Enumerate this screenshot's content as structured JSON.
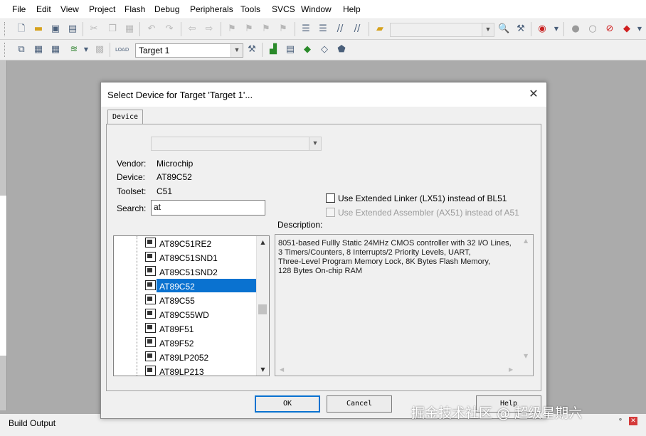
{
  "menu": [
    "File",
    "Edit",
    "View",
    "Project",
    "Flash",
    "Debug",
    "Peripherals",
    "Tools",
    "SVCS",
    "Window",
    "Help"
  ],
  "toolbar2": {
    "target_value": "Target 1"
  },
  "build_output": {
    "title": "Build Output"
  },
  "dialog": {
    "title": "Select Device for Target 'Target 1'...",
    "tab": "Device",
    "vendor_label": "Vendor:",
    "vendor_value": "Microchip",
    "device_label": "Device:",
    "device_value": "AT89C52",
    "toolset_label": "Toolset:",
    "toolset_value": "C51",
    "search_label": "Search:",
    "search_value": "at",
    "linker_option": "Use Extended Linker (LX51) instead of BL51",
    "assembler_option": "Use Extended Assembler (AX51) instead of A51",
    "description_label": "Description:",
    "description_lines": [
      "8051-based Fullly Static 24MHz CMOS controller with 32  I/O Lines,",
      "3 Timers/Counters, 8 Interrupts/2 Priority Levels, UART,",
      "Three-Level Program Memory Lock, 8K Bytes Flash Memory,",
      "128 Bytes On-chip RAM"
    ],
    "devices": [
      "AT89C51RE2",
      "AT89C51SND1",
      "AT89C51SND2",
      "AT89C52",
      "AT89C55",
      "AT89C55WD",
      "AT89F51",
      "AT89F52",
      "AT89LP2052",
      "AT89LP213"
    ],
    "selected_device": "AT89C52",
    "ok": "OK",
    "cancel": "Cancel",
    "help": "Help"
  },
  "watermark": "掘金技术社区 @ 超级星期六",
  "icons": [
    "new-file-icon",
    "open-folder-icon",
    "save-icon",
    "save-all-icon",
    "cut-icon",
    "copy-icon",
    "paste-icon",
    "undo-icon",
    "redo-icon",
    "back-icon",
    "forward-icon",
    "bookmark-icons",
    "indent-icon",
    "outdent-icon",
    "comment-icon",
    "uncomment-icon",
    "find-in-files-icon",
    "search-icon",
    "debug-icon",
    "breakpoint-icons",
    "build-icons",
    "target-options-icon",
    "manage-icons"
  ]
}
